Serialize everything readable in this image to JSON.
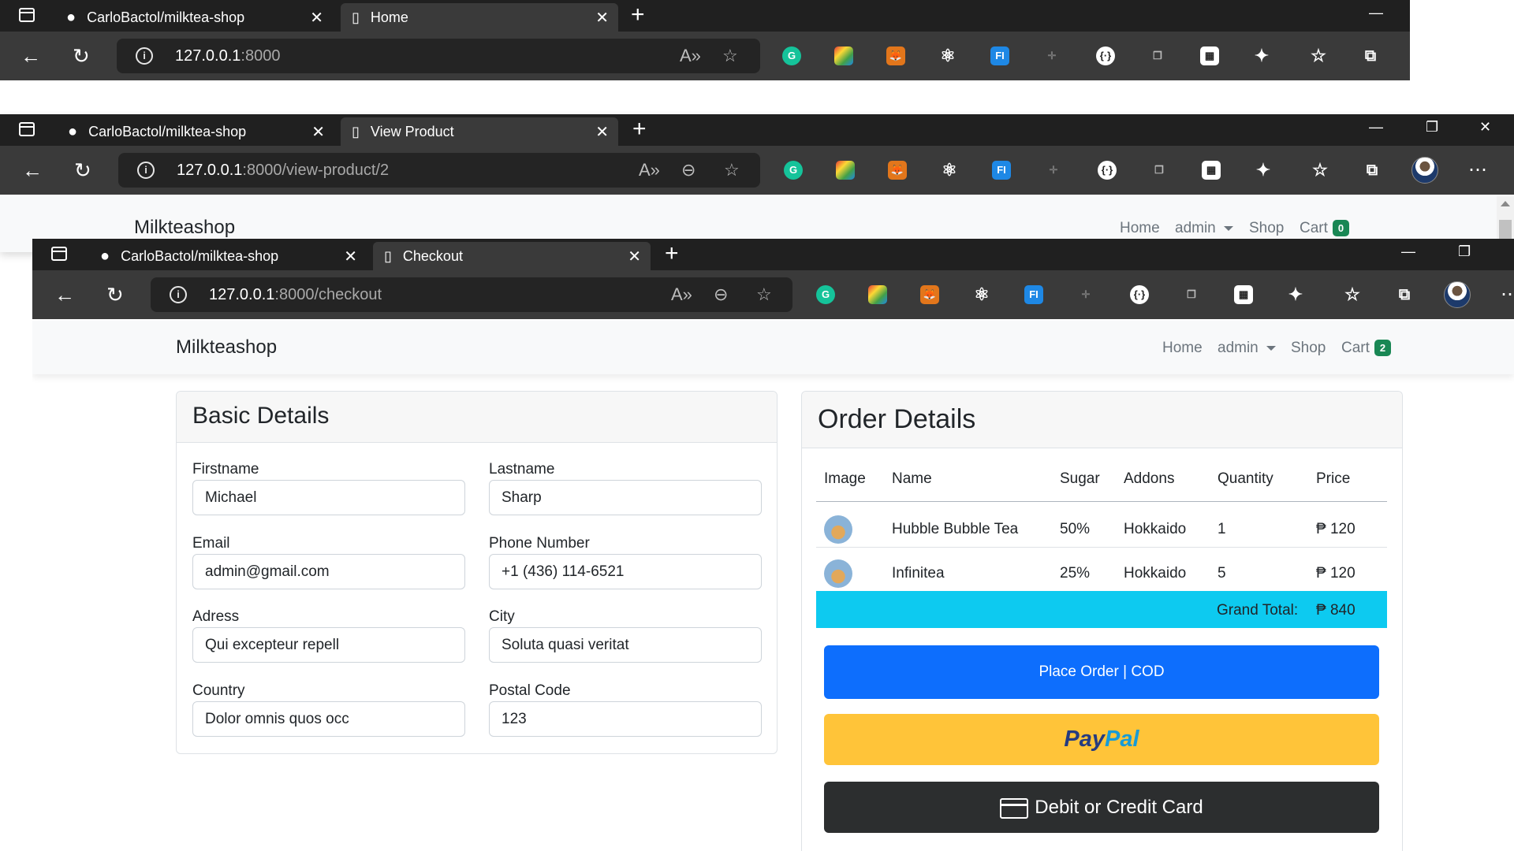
{
  "windows": {
    "home": {
      "tabs": [
        {
          "label": "CarloBactol/milktea-shop",
          "icon": "github-icon"
        },
        {
          "label": "Home",
          "icon": "document-icon"
        }
      ],
      "url_host": "127.0.0.1",
      "url_path": ":8000"
    },
    "view_product": {
      "tabs": [
        {
          "label": "CarloBactol/milktea-shop",
          "icon": "github-icon"
        },
        {
          "label": "View Product",
          "icon": "document-icon"
        }
      ],
      "url_host": "127.0.0.1",
      "url_path": ":8000/view-product/2",
      "navbar": {
        "brand": "Milkteashop",
        "home": "Home",
        "user": "admin",
        "shop": "Shop",
        "cart": "Cart",
        "cart_count": "0"
      }
    },
    "checkout": {
      "tabs": [
        {
          "label": "CarloBactol/milktea-shop",
          "icon": "github-icon"
        },
        {
          "label": "Checkout",
          "icon": "document-icon"
        }
      ],
      "url_host": "127.0.0.1",
      "url_path": ":8000/checkout",
      "navbar": {
        "brand": "Milkteashop",
        "home": "Home",
        "user": "admin",
        "shop": "Shop",
        "cart": "Cart",
        "cart_count": "2"
      }
    }
  },
  "basic_details": {
    "title": "Basic Details",
    "fields": [
      {
        "label": "Firstname",
        "value": "Michael"
      },
      {
        "label": "Lastname",
        "value": "Sharp"
      },
      {
        "label": "Email",
        "value": "admin@gmail.com"
      },
      {
        "label": "Phone Number",
        "value": "+1 (436) 114-6521"
      },
      {
        "label": "Adress",
        "value": "Qui excepteur repell"
      },
      {
        "label": "City",
        "value": "Soluta quasi veritat"
      },
      {
        "label": "Country",
        "value": "Dolor omnis quos occ"
      },
      {
        "label": "Postal Code",
        "value": "123"
      }
    ]
  },
  "order_details": {
    "title": "Order Details",
    "columns": [
      "Image",
      "Name",
      "Sugar",
      "Addons",
      "Quantity",
      "Price"
    ],
    "rows": [
      {
        "name": "Hubble Bubble Tea",
        "sugar": "50%",
        "addons": "Hokkaido",
        "quantity": "1",
        "price": "₱ 120"
      },
      {
        "name": "Infinitea",
        "sugar": "25%",
        "addons": "Hokkaido",
        "quantity": "5",
        "price": "₱ 120"
      }
    ],
    "grand_total_label": "Grand Total:",
    "grand_total_value": "₱ 840",
    "place_order_label": "Place Order | COD",
    "paypal_word_1": "Pay",
    "paypal_word_2": "Pal",
    "card_button_label": "Debit or Credit Card"
  },
  "colors": {
    "primary_button": "#0d6efd",
    "paypal_button": "#ffc439",
    "card_button": "#2c2e2f",
    "total_bar": "#0dcaf0",
    "cart_badge": "#198754"
  }
}
